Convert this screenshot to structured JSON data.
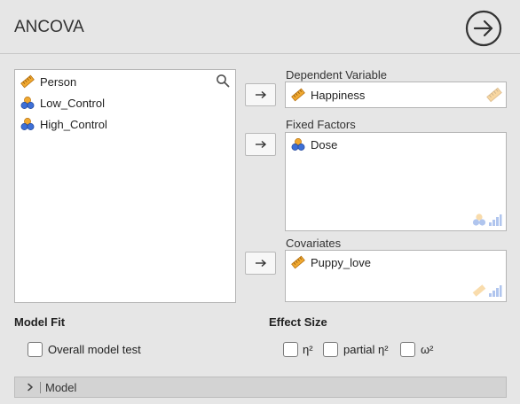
{
  "header": {
    "title": "ANCOVA"
  },
  "source": {
    "items": [
      {
        "label": "Person"
      },
      {
        "label": "Low_Control"
      },
      {
        "label": "High_Control"
      }
    ]
  },
  "targets": {
    "dependent": {
      "label": "Dependent Variable",
      "item": "Happiness"
    },
    "fixed": {
      "label": "Fixed Factors",
      "item": "Dose"
    },
    "covariates": {
      "label": "Covariates",
      "item": "Puppy_love"
    }
  },
  "model_fit": {
    "heading": "Model Fit",
    "overall": "Overall model test"
  },
  "effect_size": {
    "heading": "Effect Size",
    "eta": "η²",
    "partial_eta": "partial η²",
    "omega": "ω²"
  },
  "model_section": {
    "label": "Model"
  },
  "colors": {
    "accent": "#333333",
    "ruler": "#e8a23b",
    "nominal_blue": "#3d6fd6",
    "nominal_orange": "#f0a830"
  }
}
